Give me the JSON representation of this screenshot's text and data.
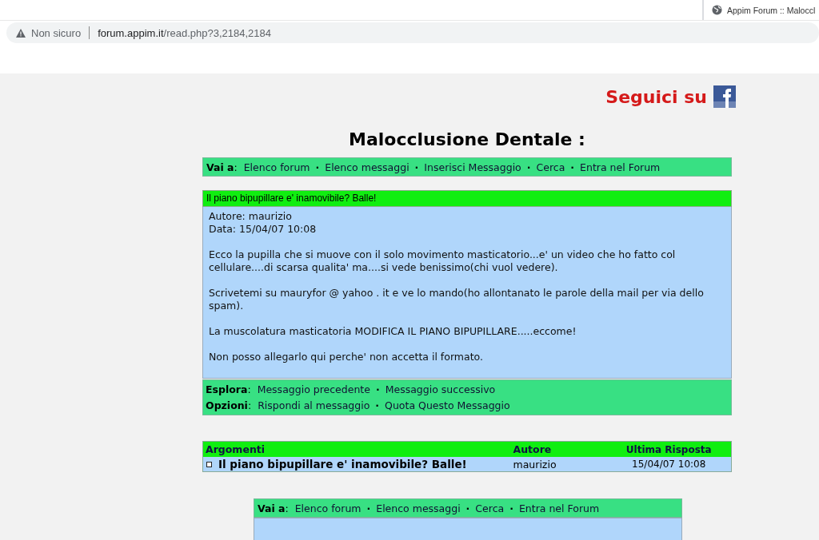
{
  "browser": {
    "tab_title": "Appim Forum :: Maloccl",
    "security": "Non sicuro",
    "url_host": "forum.appim.it",
    "url_path": "/read.php?3,2184,2184"
  },
  "follow": {
    "text": "Seguici su"
  },
  "title": "Malocclusione Dentale :",
  "top_nav": {
    "label": "**Vai a**:",
    "items": [
      {
        "kind": "link",
        "text": "Elenco forum"
      },
      {
        "kind": "sep",
        "text": "·"
      },
      {
        "kind": "link",
        "text": "Elenco messaggi"
      },
      {
        "kind": "sep",
        "text": "·"
      },
      {
        "kind": "link",
        "text": "Inserisci Messaggio"
      },
      {
        "kind": "sep",
        "text": "·"
      },
      {
        "kind": "link",
        "text": "Cerca"
      },
      {
        "kind": "sep",
        "text": "·"
      },
      {
        "kind": "link",
        "text": "Entra nel Forum"
      }
    ]
  },
  "message": {
    "subject": "Il piano bipupillare e' inamovibile? Balle!",
    "author_line": "Autore: maurizio",
    "date_line": "Data: 15/04/07 10:08",
    "paragraphs": [
      "Ecco la pupilla che si muove con il solo movimento masticatorio...e' un video che ho fatto col cellulare....di scarsa qualita' ma....si vede benissimo(chi vuol vedere).",
      "Scrivetemi su mauryfor @ yahoo . it e ve lo mando(ho allontanato le parole della mail per via dello spam).",
      "La muscolatura masticatoria MODIFICA IL PIANO BIPUPILLARE.....eccome!",
      "Non posso allegarlo qui perche' non accetta il formato."
    ]
  },
  "message_nav": [
    {
      "label": "**Esplora**:",
      "items": [
        {
          "kind": "link",
          "text": "Messaggio precedente"
        },
        {
          "kind": "sep",
          "text": "·"
        },
        {
          "kind": "link",
          "text": "Messaggio successivo"
        }
      ]
    },
    {
      "label": "**Opzioni**:",
      "items": [
        {
          "kind": "link",
          "text": "Rispondi al messaggio"
        },
        {
          "kind": "sep",
          "text": "·"
        },
        {
          "kind": "link",
          "text": "Quota Questo Messaggio"
        }
      ]
    }
  ],
  "thread_table": {
    "columns": [
      "Argomenti",
      "Autore",
      "Ultima Risposta"
    ],
    "rows": [
      {
        "subject": "Il piano bipupillare e' inamovibile? Balle!",
        "author": "maurizio",
        "last_reply": "15/04/07 10:08",
        "selected": true
      }
    ]
  },
  "bottom_nav": {
    "label": "**Vai a**:",
    "items": [
      {
        "kind": "link",
        "text": "Elenco forum"
      },
      {
        "kind": "sep",
        "text": "·"
      },
      {
        "kind": "link",
        "text": "Elenco messaggi"
      },
      {
        "kind": "sep",
        "text": "·"
      },
      {
        "kind": "link",
        "text": "Cerca"
      },
      {
        "kind": "sep",
        "text": "·"
      },
      {
        "kind": "link",
        "text": "Entra nel Forum"
      }
    ]
  }
}
